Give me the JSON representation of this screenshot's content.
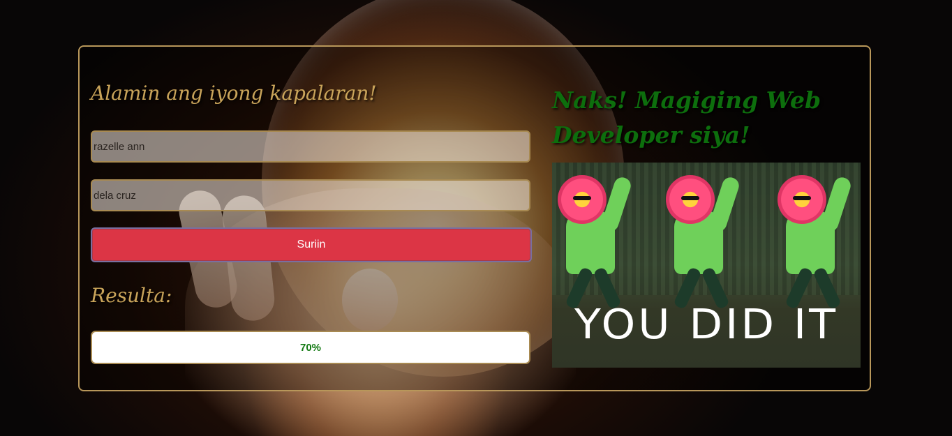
{
  "form": {
    "title": "Alamin ang iyong kapalaran!",
    "first_name_value": "razelle ann",
    "last_name_value": "dela cruz",
    "submit_label": "Suriin"
  },
  "result": {
    "label": "Resulta:",
    "percentage": "70%",
    "heading": "Naks! Magiging Web Developer siya!",
    "image_caption": "YOU DID IT"
  },
  "colors": {
    "accent_gold": "#c9a45a",
    "border_gold": "#b8975a",
    "submit_red": "#dc3545",
    "result_green": "#137a13",
    "heading_green": "#0d6e0d"
  },
  "icons": {
    "background": "crystal-ball-image"
  }
}
